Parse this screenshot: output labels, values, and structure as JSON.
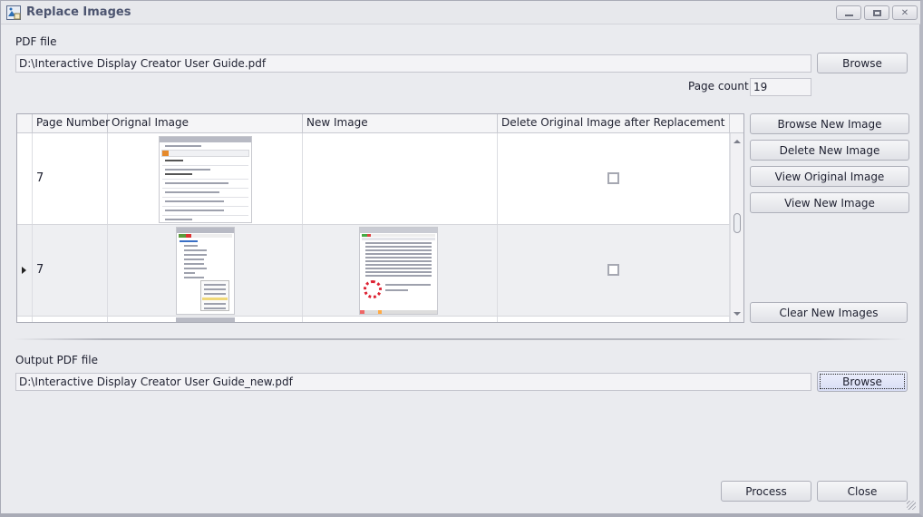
{
  "window": {
    "title": "Replace Images",
    "icon": "replace-images-icon",
    "controls": {
      "minimize": "–",
      "maximize": "□",
      "close": "✕"
    }
  },
  "pdf_file": {
    "label": "PDF file",
    "value": "D:\\Interactive Display Creator User Guide.pdf",
    "browse_label": "Browse"
  },
  "page_count": {
    "label": "Page count",
    "value": "19"
  },
  "grid": {
    "columns": [
      "",
      "Page Number",
      "Orignal Image",
      "New Image",
      "Delete Original Image after Replacement"
    ],
    "rows": [
      {
        "page_number": "7",
        "original_image": "properties-panel-thumbnail",
        "new_image": "",
        "delete_original": false,
        "selected": false
      },
      {
        "page_number": "7",
        "original_image": "tree-context-menu-thumbnail",
        "new_image": "picture-list-thumbnail",
        "delete_original": false,
        "selected": true
      }
    ]
  },
  "side_buttons": {
    "browse_new_image": "Browse New Image",
    "delete_new_image": "Delete New Image",
    "view_original_image": "View Original Image",
    "view_new_image": "View New Image",
    "clear_new_images": "Clear New Images"
  },
  "output_pdf": {
    "label": "Output PDF file",
    "value": "D:\\Interactive Display Creator User Guide_new.pdf",
    "browse_label": "Browse"
  },
  "footer": {
    "process_label": "Process",
    "close_label": "Close"
  }
}
